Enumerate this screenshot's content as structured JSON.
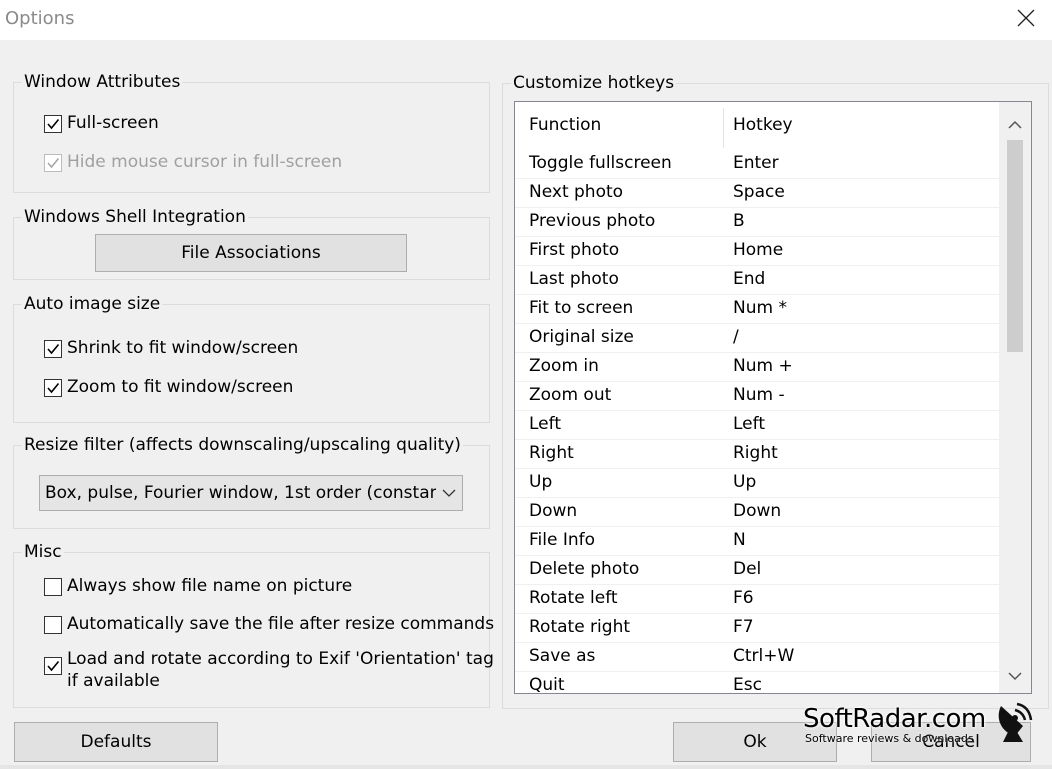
{
  "window": {
    "title": "Options"
  },
  "window_attributes": {
    "label": "Window Attributes",
    "fullscreen": {
      "label": "Full-screen",
      "checked": true
    },
    "hide_cursor": {
      "label": "Hide mouse cursor in full-screen",
      "checked": true,
      "disabled": true
    }
  },
  "shell": {
    "label": "Windows Shell Integration",
    "file_assoc_button": "File Associations"
  },
  "auto_size": {
    "label": "Auto image size",
    "shrink": {
      "label": "Shrink to fit window/screen",
      "checked": true
    },
    "zoom": {
      "label": "Zoom to fit window/screen",
      "checked": true
    }
  },
  "resize_filter": {
    "label": "Resize filter (affects downscaling/upscaling quality)",
    "selected": "Box, pulse, Fourier window, 1st order (constan"
  },
  "misc": {
    "label": "Misc",
    "show_filename": {
      "label": "Always show file name on picture",
      "checked": false
    },
    "auto_save": {
      "label": "Automatically save the file after resize commands",
      "checked": false
    },
    "exif_line1": "Load and rotate according to Exif 'Orientation' tag",
    "exif_line2": "if available",
    "exif_checked": true
  },
  "hotkeys": {
    "label": "Customize hotkeys",
    "headers": {
      "function": "Function",
      "hotkey": "Hotkey"
    },
    "rows": [
      {
        "function": "Toggle fullscreen",
        "hotkey": "Enter"
      },
      {
        "function": "Next photo",
        "hotkey": "Space"
      },
      {
        "function": "Previous photo",
        "hotkey": "B"
      },
      {
        "function": "First photo",
        "hotkey": "Home"
      },
      {
        "function": "Last photo",
        "hotkey": "End"
      },
      {
        "function": "Fit to screen",
        "hotkey": "Num *"
      },
      {
        "function": "Original size",
        "hotkey": "/"
      },
      {
        "function": "Zoom in",
        "hotkey": "Num +"
      },
      {
        "function": "Zoom out",
        "hotkey": "Num -"
      },
      {
        "function": "Left",
        "hotkey": "Left"
      },
      {
        "function": "Right",
        "hotkey": "Right"
      },
      {
        "function": "Up",
        "hotkey": "Up"
      },
      {
        "function": "Down",
        "hotkey": "Down"
      },
      {
        "function": "File Info",
        "hotkey": "N"
      },
      {
        "function": "Delete photo",
        "hotkey": "Del"
      },
      {
        "function": "Rotate left",
        "hotkey": "F6"
      },
      {
        "function": "Rotate right",
        "hotkey": "F7"
      },
      {
        "function": "Save as",
        "hotkey": "Ctrl+W"
      },
      {
        "function": "Quit",
        "hotkey": "Esc"
      }
    ]
  },
  "buttons": {
    "defaults": "Defaults",
    "ok": "Ok",
    "cancel": "Cancel"
  },
  "watermark": {
    "title": "SoftRadar.com",
    "subtitle": "Software reviews & downloads"
  }
}
